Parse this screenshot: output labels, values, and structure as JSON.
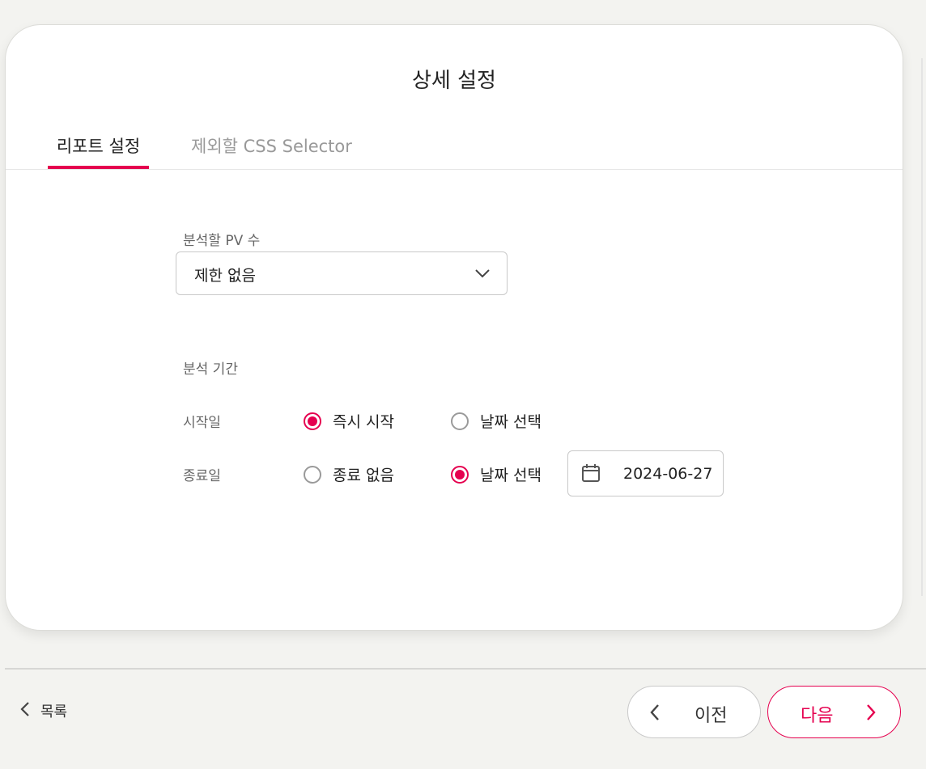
{
  "dialog": {
    "title": "상세 설정",
    "tabs": [
      {
        "label": "리포트 설정",
        "active": true
      },
      {
        "label": "제외할 CSS Selector",
        "active": false
      }
    ]
  },
  "form": {
    "pv_label": "분석할 PV 수",
    "pv_select_value": "제한 없음",
    "period_label": "분석 기간",
    "start": {
      "label": "시작일",
      "options": [
        {
          "label": "즉시 시작",
          "selected": true
        },
        {
          "label": "날짜 선택",
          "selected": false
        }
      ]
    },
    "end": {
      "label": "종료일",
      "options": [
        {
          "label": "종료 없음",
          "selected": false
        },
        {
          "label": "날짜 선택",
          "selected": true
        }
      ],
      "date_value": "2024-06-27"
    }
  },
  "footer": {
    "back_label": "목록",
    "prev_label": "이전",
    "next_label": "다음"
  },
  "colors": {
    "accent": "#e5004f",
    "background": "#f3f3f0"
  }
}
